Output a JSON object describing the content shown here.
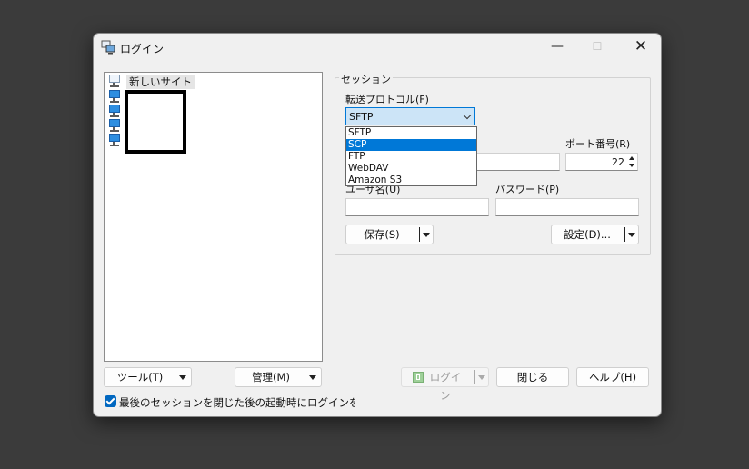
{
  "window": {
    "title": "ログイン",
    "minimize_glyph": "—",
    "maximize_glyph": "☐",
    "close_glyph": "✕"
  },
  "site_tree": {
    "items": [
      {
        "label": "新しいサイト",
        "icon": "new-site-icon"
      },
      {
        "label": "",
        "icon": "computer-icon"
      },
      {
        "label": "",
        "icon": "computer-icon"
      },
      {
        "label": "",
        "icon": "computer-icon"
      },
      {
        "label": "",
        "icon": "computer-icon"
      }
    ]
  },
  "session": {
    "group_title": "セッション",
    "protocol_label": "転送プロトコル(F)",
    "protocol_value": "SFTP",
    "protocol_options": [
      "SFTP",
      "SCP",
      "FTP",
      "WebDAV",
      "Amazon S3"
    ],
    "protocol_highlighted": "SCP",
    "port_label": "ポート番号(R)",
    "port_value": "22",
    "username_label_partial": "ユーザ名(U)",
    "password_label": "パスワード(P)",
    "save_button": "保存(S)",
    "advanced_button": "設定(D)..."
  },
  "footer": {
    "tools_button": "ツール(T)",
    "manage_button": "管理(M)",
    "login_button": "ログイン",
    "close_button": "閉じる",
    "help_button": "ヘルプ(H)",
    "checkbox_label": "最後のセッションを閉じた後の起動時にログインを表示(S)",
    "checkbox_checked": true
  },
  "colors": {
    "accent": "#0078d7",
    "combo_focus_bg": "#cce4f7",
    "dialog_bg": "#f0f0f0",
    "desktop_bg": "#3b3b3b"
  }
}
